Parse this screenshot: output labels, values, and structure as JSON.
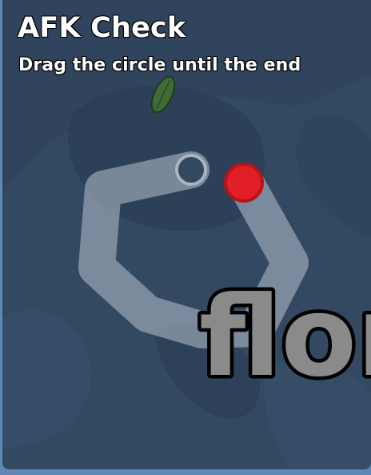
{
  "dialog": {
    "title": "AFK Check",
    "instruction": "Drag the circle until the end"
  },
  "watermark": {
    "text": "flor"
  },
  "colors": {
    "panel_background": "#334962",
    "frame_background": "#5f88b4",
    "path_color": "#97a4b3",
    "handle_color": "#e01f26",
    "handle_outline": "#b7141a",
    "leaf_color": "#3f6b35"
  },
  "icons": {
    "leaf": "leaf-icon",
    "drag_handle": "red-circle",
    "path_end": "hollow-ring"
  }
}
